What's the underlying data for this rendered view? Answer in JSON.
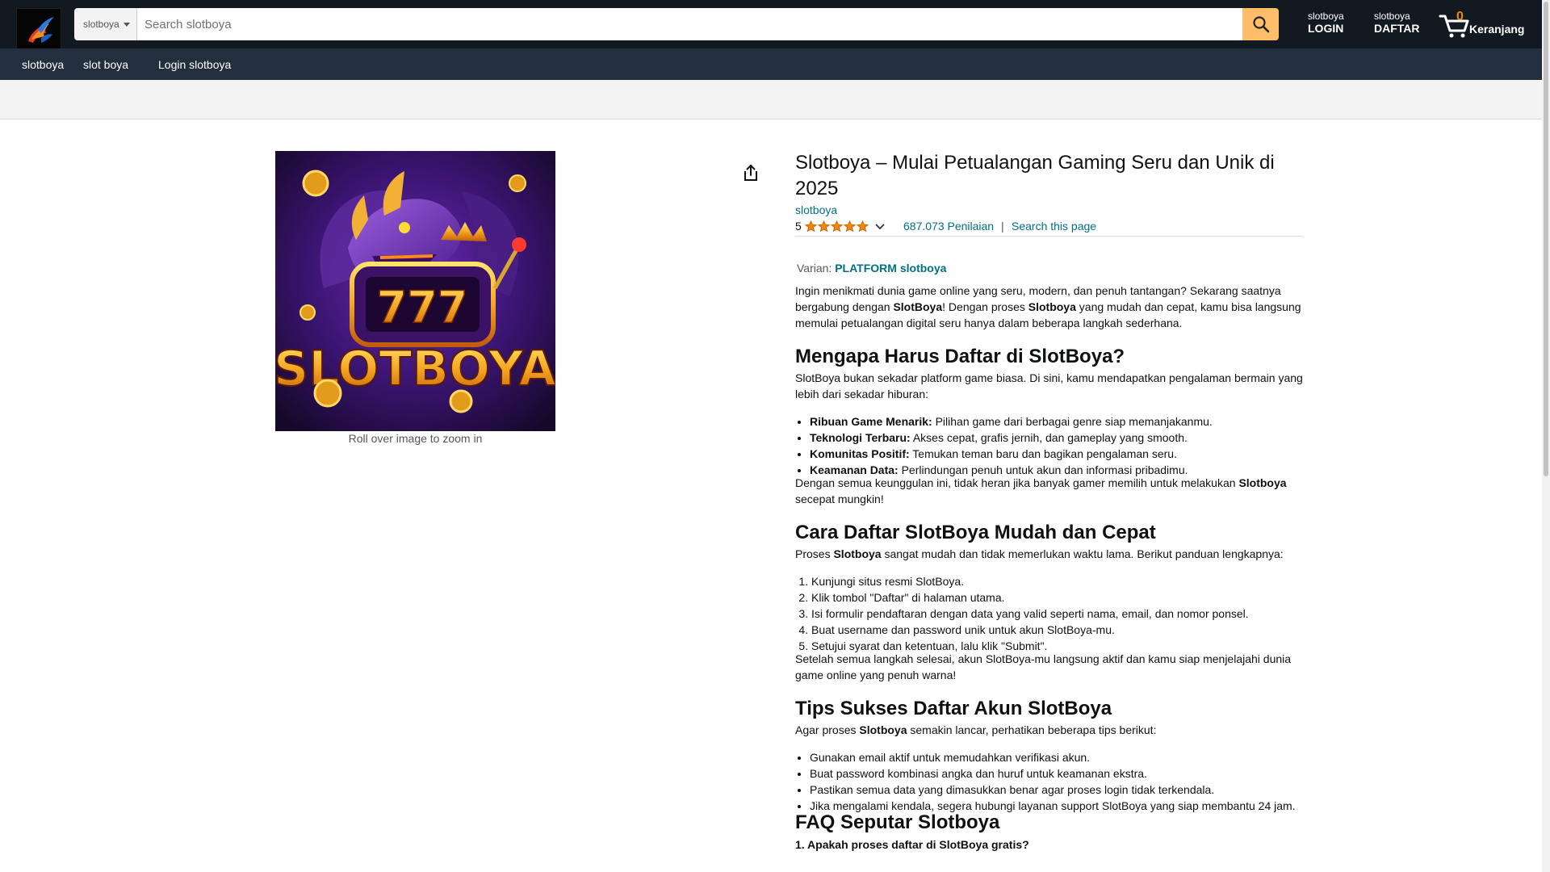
{
  "header": {
    "search_category": "slotboya",
    "search_placeholder": "Search slotboya",
    "login": {
      "small": "slotboya",
      "big": "LOGIN"
    },
    "register": {
      "small": "slotboya",
      "big": "DAFTAR"
    },
    "cart": {
      "count": "0",
      "label": "Keranjang"
    }
  },
  "subnav": {
    "items": [
      "slotboya",
      "slot boya",
      "Login slotboya"
    ]
  },
  "product": {
    "image_text": "SLOTBOYA",
    "image_reels": "777",
    "zoom_hint": "Roll over image to zoom in",
    "title": "Slotboya – Mulai Petualangan Gaming Seru dan Unik di 2025",
    "brand": "slotboya",
    "rating_value": "5",
    "rating_stars": 5,
    "ratings_count": "687.073 Penilaian",
    "separator": "|",
    "search_page_link": "Search this page",
    "variant_label": "Varian:",
    "variant_value": "PLATFORM slotboya"
  },
  "content": {
    "intro_1": "Ingin menikmati dunia game online yang seru, modern, dan penuh tantangan? Sekarang saatnya bergabung dengan ",
    "intro_b1": "SlotBoya",
    "intro_2": "! Dengan proses ",
    "intro_b2": "Slotboya",
    "intro_3": " yang mudah dan cepat, kamu bisa langsung memulai petualangan digital seru hanya dalam beberapa langkah sederhana.",
    "h_why": "Mengapa Harus Daftar di SlotBoya?",
    "why_text": "SlotBoya bukan sekadar platform game biasa. Di sini, kamu mendapatkan pengalaman bermain yang lebih dari sekadar hiburan:",
    "why_items": [
      {
        "b": "Ribuan Game Menarik:",
        "t": " Pilihan game dari berbagai genre siap memanjakanmu."
      },
      {
        "b": "Teknologi Terbaru:",
        "t": " Akses cepat, grafis jernih, dan gameplay yang smooth."
      },
      {
        "b": "Komunitas Positif:",
        "t": " Temukan teman baru dan bagikan pengalaman seru."
      },
      {
        "b": "Keamanan Data:",
        "t": " Perlindungan penuh untuk akun dan informasi pribadimu."
      }
    ],
    "why_after_1": "Dengan semua keunggulan ini, tidak heran jika banyak gamer memilih untuk melakukan ",
    "why_after_b": "Slotboya",
    "why_after_2": " secepat mungkin!",
    "h_how": "Cara Daftar SlotBoya Mudah dan Cepat",
    "how_1": "Proses ",
    "how_b": "Slotboya",
    "how_2": " sangat mudah dan tidak memerlukan waktu lama. Berikut panduan lengkapnya:",
    "how_steps": [
      "Kunjungi situs resmi SlotBoya.",
      "Klik tombol \"Daftar\" di halaman utama.",
      "Isi formulir pendaftaran dengan data yang valid seperti nama, email, dan nomor ponsel.",
      "Buat username dan password unik untuk akun SlotBoya-mu.",
      "Setujui syarat dan ketentuan, lalu klik \"Submit\"."
    ],
    "how_after": "Setelah semua langkah selesai, akun SlotBoya-mu langsung aktif dan kamu siap menjelajahi dunia game online yang penuh warna!",
    "h_tips": "Tips Sukses Daftar Akun SlotBoya",
    "tips_1": "Agar proses ",
    "tips_b": "Slotboya",
    "tips_2": " semakin lancar, perhatikan beberapa tips berikut:",
    "tips_items": [
      "Gunakan email aktif untuk memudahkan verifikasi akun.",
      "Buat password kombinasi angka dan huruf untuk keamanan ekstra.",
      "Pastikan semua data yang dimasukkan benar agar proses login tidak terkendala.",
      "Jika mengalami kendala, segera hubungi layanan support SlotBoya yang siap membantu 24 jam."
    ],
    "h_faq": "FAQ Seputar Slotboya",
    "faq_q1": "1. Apakah proses daftar di SlotBoya gratis?"
  },
  "colors": {
    "header": "#131921",
    "subnav": "#232f3e",
    "search_button": "#febd69",
    "link": "#007185",
    "star": "#f08804"
  }
}
